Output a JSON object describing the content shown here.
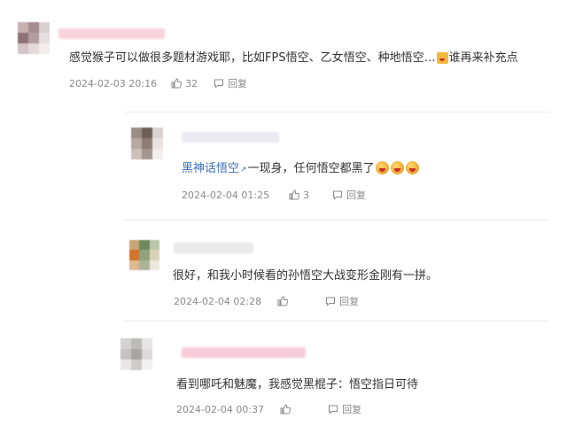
{
  "comments": [
    {
      "text": "感觉猴子可以做很多题材游戏耶，比如FPS悟空、乙女悟空、种地悟空…",
      "text_tail": "谁再来补充点",
      "emoji": "smiling-cat-emoji",
      "date": "2024-02-03 20:16",
      "likes": "32",
      "reply_label": "回复"
    },
    {
      "topic": "黑神话悟空",
      "text": "一现身，任何悟空都黑了",
      "emoji": "laughing-tears-emoji",
      "date": "2024-02-04 01:25",
      "likes": "3",
      "reply_label": "回复"
    },
    {
      "text": "很好，和我小时候看的孙悟空大战变形金刚有一拼。",
      "date": "2024-02-04 02:28",
      "reply_label": "回复"
    },
    {
      "text": "看到哪吒和魅魔，我感觉黑棍子：悟空指日可待",
      "date": "2024-02-04 00:37",
      "reply_label": "回复"
    }
  ],
  "colors": {
    "link": "#3b6fb6",
    "meta": "#8a8a8a",
    "text": "#333333",
    "name_blur": "#f6c6d2"
  },
  "icons": {
    "like": "thumbs-up-icon",
    "reply": "reply-bubble-icon",
    "topic_link": "link-icon"
  }
}
